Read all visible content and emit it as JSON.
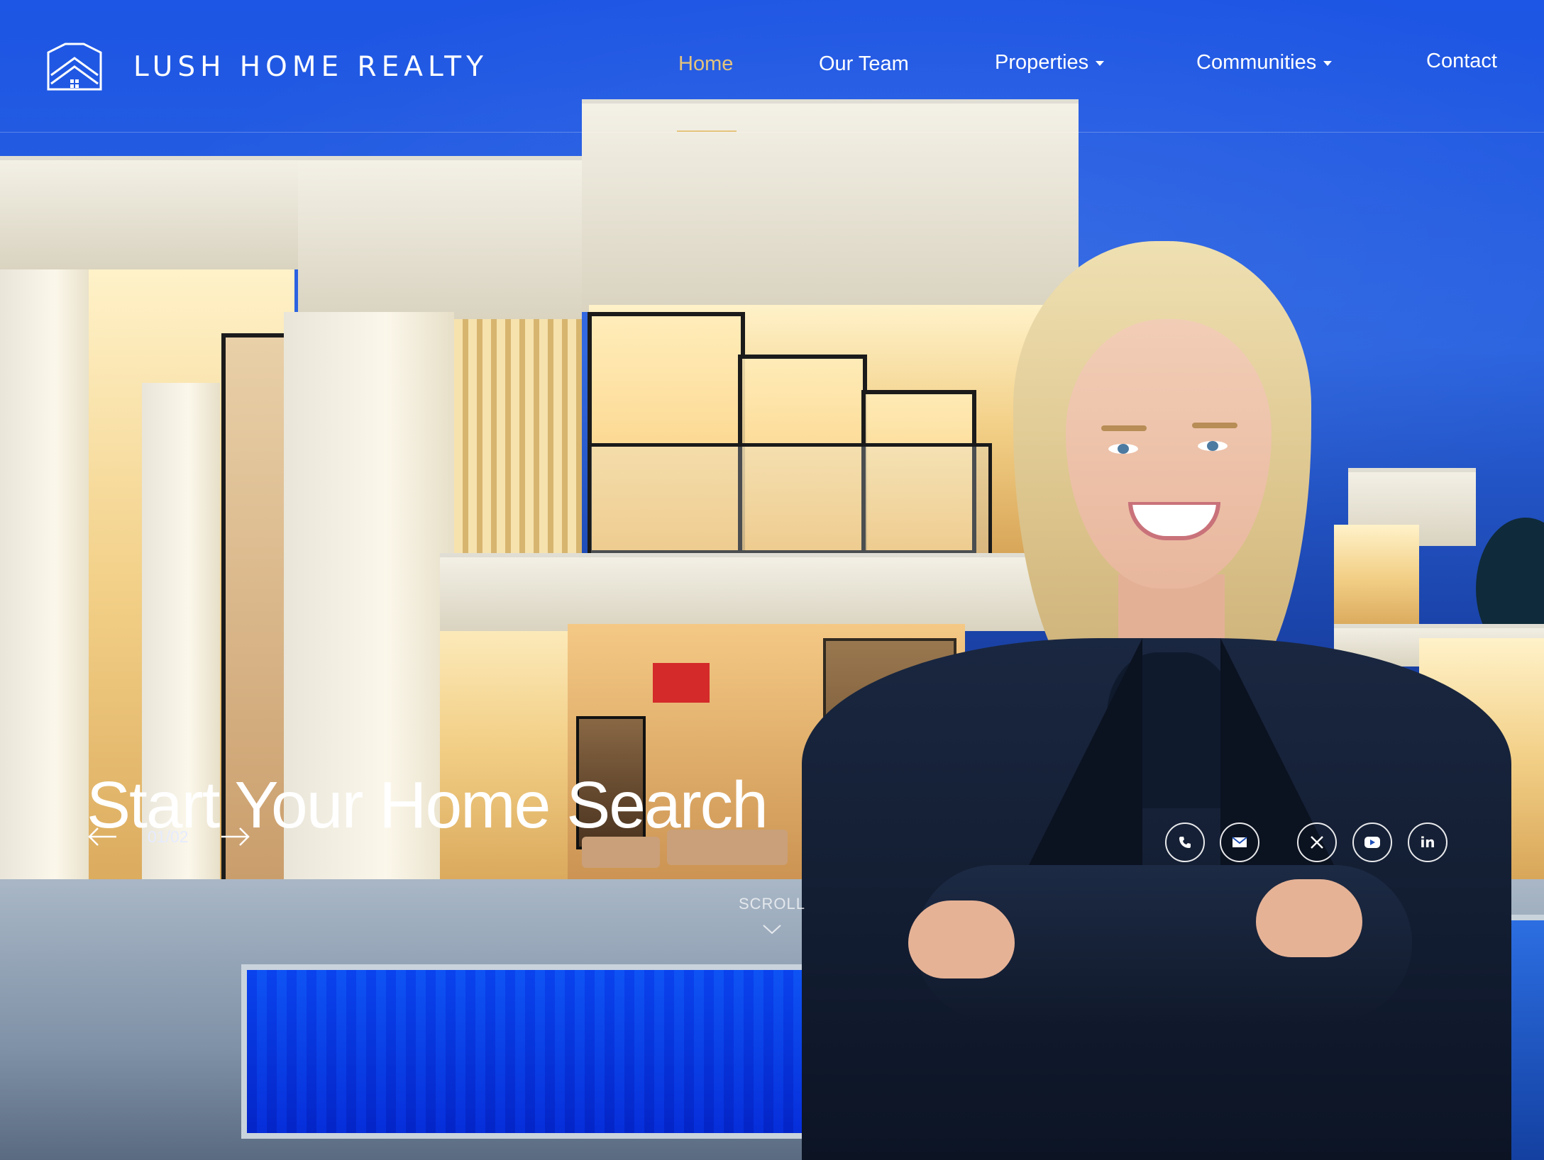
{
  "brand": {
    "name": "LUSH HOME REALTY",
    "logo_icon": "house-chevron-icon"
  },
  "nav": {
    "items": [
      {
        "label": "Home",
        "active": true
      },
      {
        "label": "Our Team",
        "active": false
      },
      {
        "label": "Properties",
        "has_dropdown": true
      },
      {
        "label": "Communities",
        "has_dropdown": true
      },
      {
        "label": "Contact",
        "active": false
      }
    ]
  },
  "hero": {
    "headline": "Start Your Home Search",
    "slide_counter": "01/02",
    "prev_icon": "arrow-left-icon",
    "next_icon": "arrow-right-icon",
    "scroll_label": "SCROLL"
  },
  "social": {
    "icons": [
      "phone-icon",
      "email-icon",
      "x-icon",
      "youtube-icon",
      "linkedin-icon"
    ],
    "linkedin_text": "in"
  },
  "colors": {
    "accent_gold": "#e4c37c",
    "sky_blue": "#1d55e4",
    "text_white": "#ffffff"
  }
}
